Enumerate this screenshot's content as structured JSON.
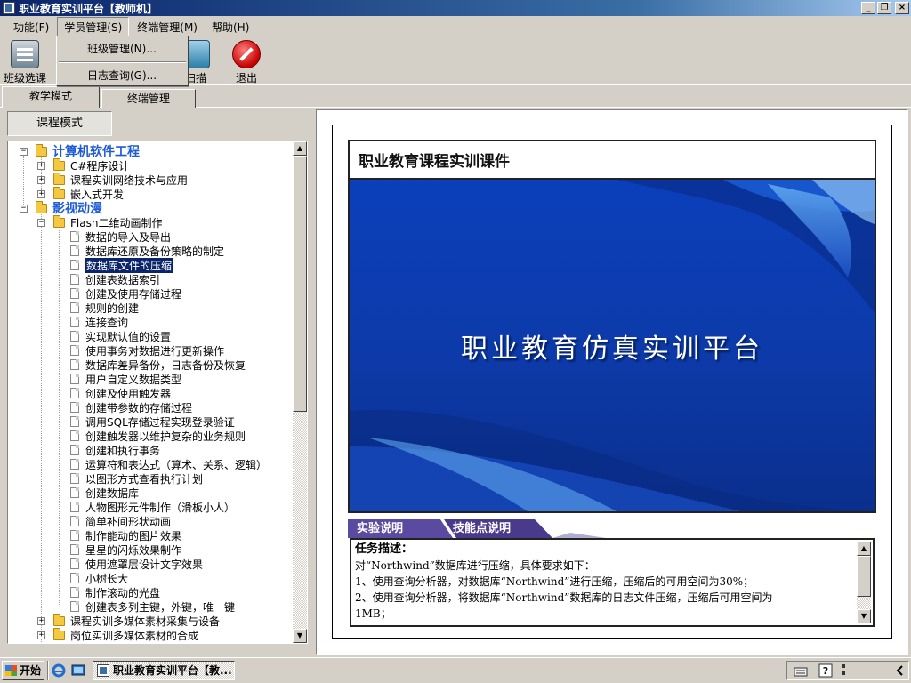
{
  "window": {
    "title": "职业教育实训平台【教师机】",
    "minimize_glyph": "_",
    "restore_glyph": "❐",
    "close_glyph": "×"
  },
  "menubar": {
    "items": [
      "功能(F)",
      "学员管理(S)",
      "终端管理(M)",
      "帮助(H)"
    ]
  },
  "dropdown": {
    "items": [
      "班级管理(N)...",
      "日志查询(G)..."
    ]
  },
  "toolbar": {
    "class_select": "班级选课",
    "scan": "扫描",
    "exit": "退出"
  },
  "tabs": [
    "教学模式",
    "终端管理"
  ],
  "left": {
    "mode_button": "课程模式"
  },
  "tree": {
    "root1": {
      "label": "计算机软件工程",
      "children": [
        "C#程序设计",
        "课程实训网络技术与应用",
        "嵌入式开发"
      ]
    },
    "root2": {
      "label": "影视动漫",
      "folder": "Flash二维动画制作",
      "leaves": [
        "数据的导入及导出",
        "数据库还原及备份策略的制定",
        "数据库文件的压缩",
        "创建表数据索引",
        "创建及使用存储过程",
        "规则的创建",
        "连接查询",
        "实现默认值的设置",
        "使用事务对数据进行更新操作",
        "数据库差异备份，日志备份及恢复",
        "用户自定义数据类型",
        "创建及使用触发器",
        "创建带参数的存储过程",
        "调用SQL存储过程实现登录验证",
        "创建触发器以维护复杂的业务规则",
        "创建和执行事务",
        "运算符和表达式（算术、关系、逻辑）",
        "以图形方式查看执行计划",
        "创建数据库",
        "人物图形元件制作（滑板小人）",
        "简单补间形状动画",
        "制作能动的图片效果",
        "星星的闪烁效果制作",
        "使用遮罩层设计文字效果",
        "小树长大",
        "制作滚动的光盘",
        "创建表多列主键，外键，唯一键"
      ],
      "more_folders": [
        "课程实训多媒体素材采集与设备",
        "岗位实训多媒体素材的合成"
      ]
    }
  },
  "course": {
    "header": "职业教育课程实训课件",
    "banner_title": "职业教育仿真实训平台"
  },
  "info_tabs": [
    "实验说明",
    "技能点说明"
  ],
  "info": {
    "heading": "任务描述：",
    "lines": [
      "对“Northwind”数据库进行压缩，具体要求如下：",
      "1、使用查询分析器，对数据库“Northwind”进行压缩，压缩后的可用空间为30%；",
      "2、使用查询分析器，将数据库“Northwind”数据库的日志文件压缩，压缩后可用空间为",
      "1MB；"
    ]
  },
  "taskbar": {
    "start": "开始",
    "task_item": "职业教育实训平台【教..."
  },
  "colors": {
    "titlebar": "#0a246a",
    "banner_blue": "#0b3fbb",
    "tree_root": "#1e5bd6",
    "selection": "#0a246a",
    "info_tab": "#4a3a8c"
  }
}
